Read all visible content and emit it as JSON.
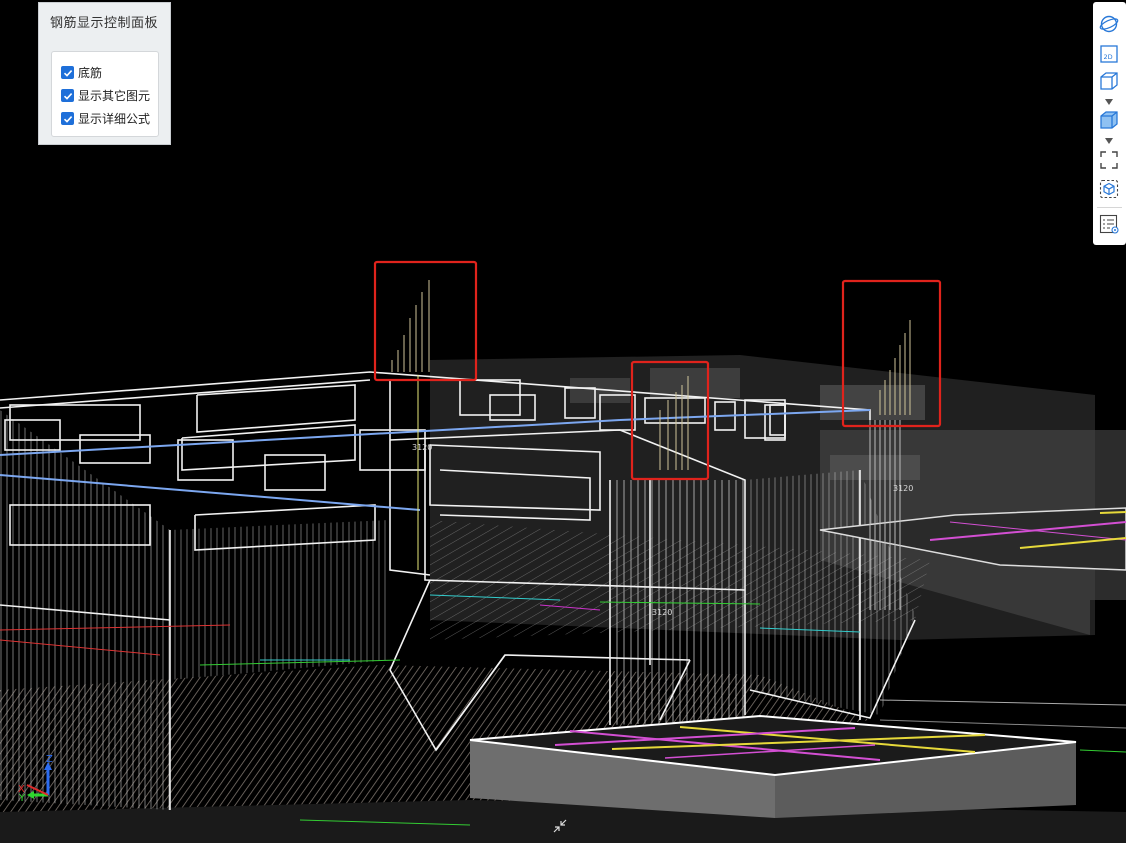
{
  "control_panel": {
    "title": "钢筋显示控制面板",
    "options": [
      {
        "label": "底筋",
        "checked": true
      },
      {
        "label": "显示其它图元",
        "checked": true
      },
      {
        "label": "显示详细公式",
        "checked": true
      }
    ]
  },
  "toolbar": {
    "buttons": [
      {
        "name": "orbit-icon"
      },
      {
        "name": "view-2d-icon",
        "text": "2D"
      },
      {
        "name": "view-3d-box-icon"
      },
      {
        "name": "view-3d-solid-icon"
      },
      {
        "name": "fit-view-icon"
      },
      {
        "name": "isolate-view-icon"
      },
      {
        "name": "layer-list-icon"
      }
    ]
  },
  "scene": {
    "dimension_labels": [
      "3120",
      "3120",
      "3120"
    ],
    "axis_labels": {
      "x": "X",
      "y": "Y",
      "z": "Z"
    },
    "highlight_color": "#e0231c"
  }
}
